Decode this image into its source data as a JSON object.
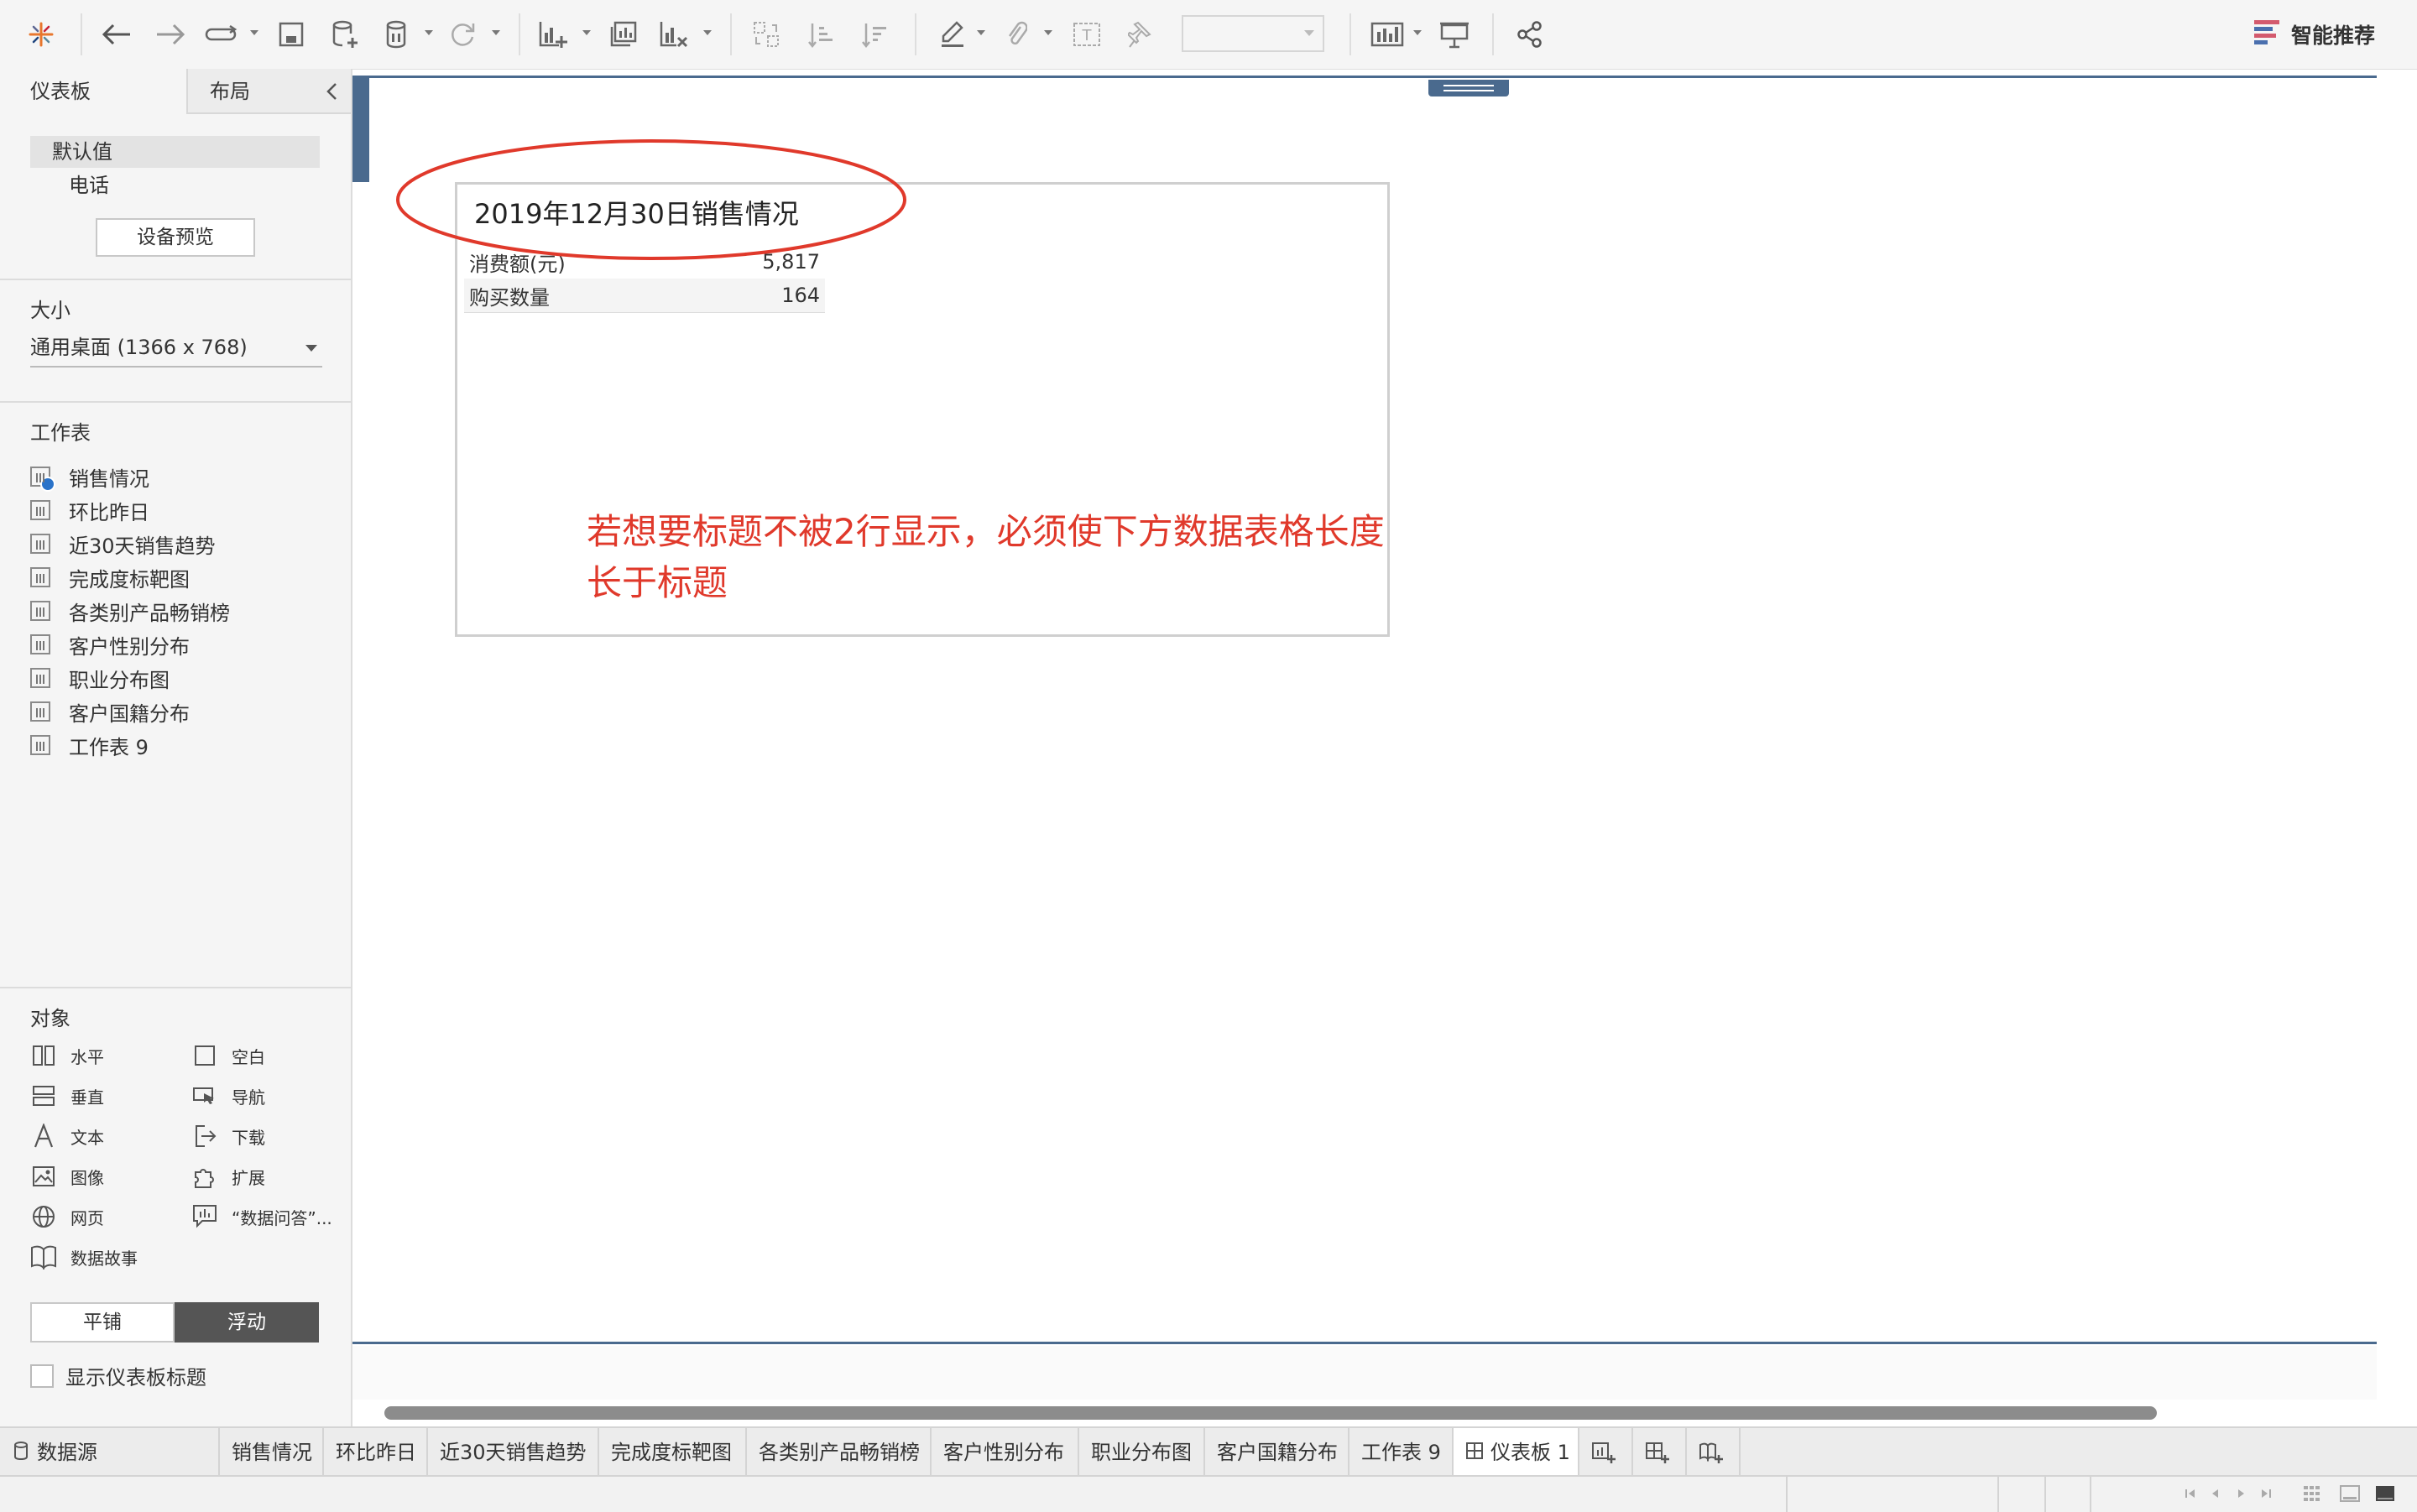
{
  "left_panel": {
    "tabs": {
      "dashboard": "仪表板",
      "layout": "布局"
    },
    "device": {
      "default": "默认值",
      "phone": "电话",
      "preview_button": "设备预览"
    },
    "size": {
      "title": "大小",
      "value": "通用桌面 (1366 x 768)"
    },
    "worksheets": {
      "title": "工作表",
      "items": [
        "销售情况",
        "环比昨日",
        "近30天销售趋势",
        "完成度标靶图",
        "各类别产品畅销榜",
        "客户性别分布",
        "职业分布图",
        "客户国籍分布",
        "工作表 9"
      ]
    },
    "objects": {
      "title": "对象",
      "horizontal": "水平",
      "blank": "空白",
      "vertical": "垂直",
      "navigation": "导航",
      "text": "文本",
      "download": "下载",
      "image": "图像",
      "extension": "扩展",
      "webpage": "网页",
      "ask_data": "“数据问答”...",
      "story": "数据故事"
    },
    "mode": {
      "tiled": "平铺",
      "floating": "浮动"
    },
    "show_title": "显示仪表板标题"
  },
  "toolbar": {
    "smart_recommend": "智能推荐"
  },
  "dashboard": {
    "sheet_title": "2019年12月30日销售情况",
    "rows": [
      {
        "label": "消费额(元)",
        "value": "5,817"
      },
      {
        "label": "购买数量",
        "value": "164"
      }
    ],
    "annotation": "若想要标题不被2行显示，必须使下方数据表格长度长于标题"
  },
  "bottom_tabs": {
    "datasource": "数据源",
    "sheets": [
      "销售情况",
      "环比昨日",
      "近30天销售趋势",
      "完成度标靶图",
      "各类别产品畅销榜",
      "客户性别分布",
      "职业分布图",
      "客户国籍分布",
      "工作表 9"
    ],
    "active_dashboard": "仪表板 1"
  },
  "colors": {
    "accent": "#4a6a8e",
    "annotation": "#e0392b",
    "active_toggle": "#555555"
  }
}
